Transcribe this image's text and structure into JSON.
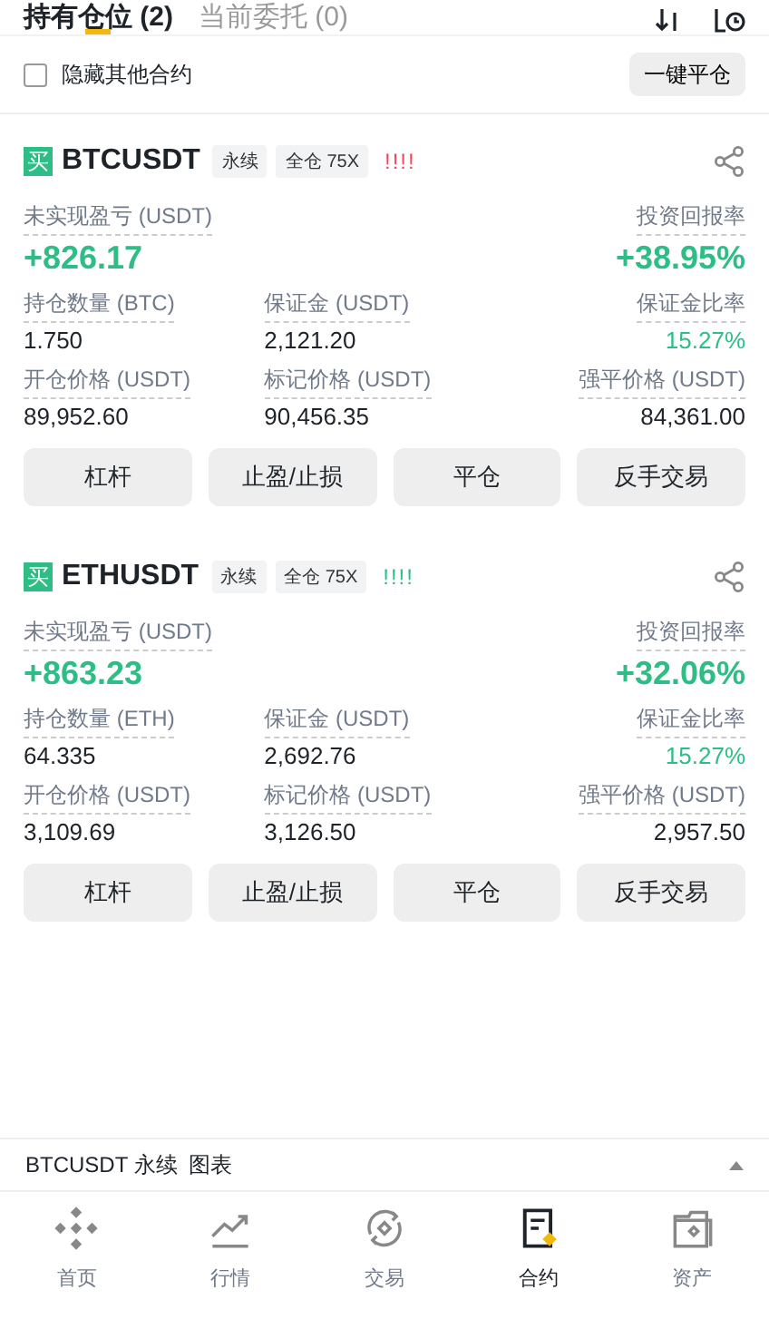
{
  "tabs": [
    {
      "label": "持有仓位 (2)",
      "selected": true
    },
    {
      "label": "当前委托 (0)",
      "selected": false
    }
  ],
  "hide_others": {
    "label": "隐藏其他合约",
    "checked": false
  },
  "close_all_button": "一键平仓",
  "positions": [
    {
      "side": "买",
      "symbol": "BTCUSDT",
      "contract_type": "永续",
      "margin_mode": "全仓 75X",
      "risk": "!!!!",
      "color": "#f6465d",
      "pnl": {
        "label": "未实现盈亏 (USDT)",
        "value": "+826.17"
      },
      "roi": {
        "label": "投资回报率",
        "value": "+38.95%"
      },
      "size": {
        "label": "持仓数量 (BTC)",
        "value": "1.750"
      },
      "margin": {
        "label": "保证金 (USDT)",
        "value": "2,121.20"
      },
      "margin_ratio": {
        "label": "保证金比率",
        "value": "15.27%"
      },
      "entry_price": {
        "label": "开仓价格 (USDT)",
        "value": "89,952.60"
      },
      "mark_price": {
        "label": "标记价格 (USDT)",
        "value": "90,456.35"
      },
      "liq_price": {
        "label": "强平价格 (USDT)",
        "value": "84,361.00"
      },
      "actions": [
        "杠杆",
        "止盈/止损",
        "平仓",
        "反手交易"
      ]
    },
    {
      "side": "买",
      "symbol": "ETHUSDT",
      "contract_type": "永续",
      "margin_mode": "全仓 75X",
      "risk": "!!!!",
      "color": "#2ebd85",
      "pnl": {
        "label": "未实现盈亏 (USDT)",
        "value": "+863.23"
      },
      "roi": {
        "label": "投资回报率",
        "value": "+32.06%"
      },
      "size": {
        "label": "持仓数量 (ETH)",
        "value": "64.335"
      },
      "margin": {
        "label": "保证金 (USDT)",
        "value": "2,692.76"
      },
      "margin_ratio": {
        "label": "保证金比率",
        "value": "15.27%"
      },
      "entry_price": {
        "label": "开仓价格 (USDT)",
        "value": "3,109.69"
      },
      "mark_price": {
        "label": "标记价格 (USDT)",
        "value": "3,126.50"
      },
      "liq_price": {
        "label": "强平价格 (USDT)",
        "value": "2,957.50"
      },
      "actions": [
        "杠杆",
        "止盈/止损",
        "平仓",
        "反手交易"
      ]
    }
  ],
  "chart_bar": {
    "symbol": "BTCUSDT 永续",
    "label": "图表",
    "expanded": false
  },
  "nav": [
    {
      "label": "首页",
      "selected": false
    },
    {
      "label": "行情",
      "selected": false
    },
    {
      "label": "交易",
      "selected": false
    },
    {
      "label": "合约",
      "selected": true
    },
    {
      "label": "资产",
      "selected": false
    }
  ]
}
